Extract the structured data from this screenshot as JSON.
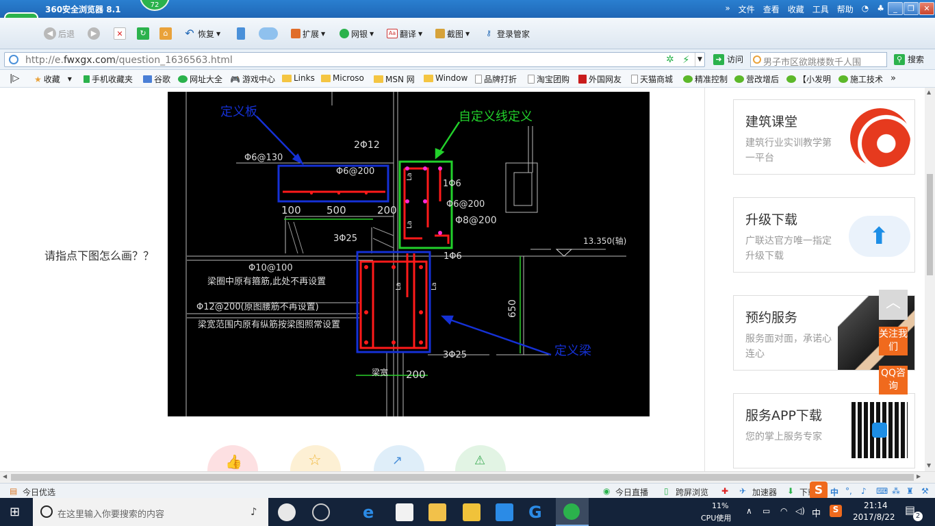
{
  "window": {
    "title": "360安全浏览器 8.1",
    "badge": "72",
    "menu": [
      "文件",
      "查看",
      "收藏",
      "工具",
      "帮助"
    ]
  },
  "toolbar": {
    "back": "后退",
    "restore": "恢复",
    "extend": "扩展",
    "bank": "网银",
    "translate": "翻译",
    "screenshot": "截图",
    "login": "登录管家"
  },
  "address": {
    "url_prefix": "http://e.",
    "url_domain": "fwxgx.com",
    "url_path": "/question_1636563.html",
    "go": "访问",
    "search_placeholder": "男子市区欲跳楼数千人围",
    "search_btn": "搜索"
  },
  "bookmarks": [
    "收藏",
    "手机收藏夹",
    "谷歌",
    "网址大全",
    "游戏中心",
    "Links",
    "Microso",
    "MSN 网",
    "Window",
    "品牌打折",
    "淘宝团购",
    "外国网友",
    "天猫商城",
    "精准控制",
    "营改增后",
    "【小发明",
    "施工技术"
  ],
  "question": {
    "text": "请指点下图怎么画？？"
  },
  "drawing": {
    "labels": {
      "slab": "定义板",
      "custom_line": "自定义线定义",
      "beam": "定义梁",
      "slab_rebar": "Φ6@130",
      "top_bar": "2Φ12",
      "slab_dist": "Φ6@200",
      "stirrup_small": "1Φ6",
      "stirrup_mid": "Φ6@200",
      "stirrup_8": "Φ8@200",
      "dim_100": "100",
      "dim_500": "500",
      "dim_200a": "200",
      "bar_325a": "3Φ25",
      "elevation": "13.350(轴)",
      "stirrup_small2": "1Φ6",
      "stirrup_10": "Φ10@100",
      "note1": "梁圈中原有箍筋,此处不再设置",
      "waist": "Φ12@200(原图腰筋不再设置)",
      "note2": "梁宽范围内原有纵筋按梁图照常设置",
      "dim_650": "650",
      "bar_325b": "3Φ25",
      "beam_width": "梁宽",
      "dim_200b": "200",
      "la1": "La",
      "la2": "La",
      "la3": "La",
      "la4": "La"
    }
  },
  "sidebar": {
    "cards": [
      {
        "title": "建筑课堂",
        "desc": "建筑行业实训教学第一平台"
      },
      {
        "title": "升级下载",
        "desc": "广联达官方唯一指定升级下载"
      },
      {
        "title": "预约服务",
        "desc": "服务面对面，承诺心连心"
      },
      {
        "title": "服务APP下载",
        "desc": "您的掌上服务专家"
      }
    ],
    "float": {
      "follow": "关注我们",
      "qq": "QQ咨询"
    }
  },
  "status": {
    "left": "今日优选",
    "live": "今日直播",
    "cross": "跨屏浏览",
    "accel": "加速器",
    "download": "下载"
  },
  "taskbar": {
    "search_placeholder": "在这里输入你要搜索的内容",
    "cpu_pct": "11%",
    "cpu_label": "CPU使用",
    "ime": "中",
    "time": "21:14",
    "date": "2017/8/22",
    "notifications": "2"
  },
  "colors": {
    "title_blue": "#1f66b5",
    "logo_green": "#2bb24c",
    "float_orange": "#f06a1d"
  }
}
